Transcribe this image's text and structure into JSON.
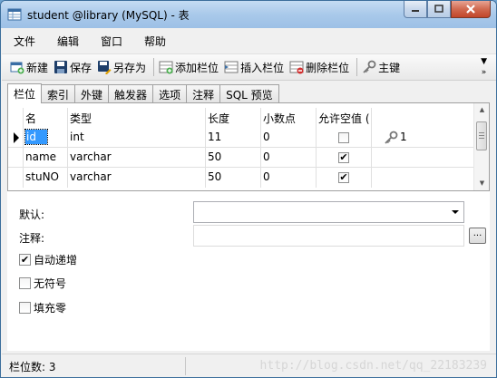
{
  "window": {
    "title": "student @library (MySQL) - 表"
  },
  "menu": [
    "文件",
    "编辑",
    "窗口",
    "帮助"
  ],
  "toolbar": {
    "new_label": "新建",
    "save_label": "保存",
    "save_as_label": "另存为",
    "add_field_label": "添加栏位",
    "insert_field_label": "插入栏位",
    "delete_field_label": "删除栏位",
    "primary_key_label": "主键"
  },
  "tabs": [
    "栏位",
    "索引",
    "外键",
    "触发器",
    "选项",
    "注释",
    "SQL 预览"
  ],
  "grid": {
    "columns": [
      "名",
      "类型",
      "长度",
      "小数点",
      "允许空值 ("
    ],
    "rows": [
      {
        "name": "id",
        "type": "int",
        "length": "11",
        "decimals": "0",
        "nullable": false,
        "key": "1"
      },
      {
        "name": "name",
        "type": "varchar",
        "length": "50",
        "decimals": "0",
        "nullable": true,
        "key": ""
      },
      {
        "name": "stuNO",
        "type": "varchar",
        "length": "50",
        "decimals": "0",
        "nullable": true,
        "key": ""
      }
    ]
  },
  "properties": {
    "default_label": "默认:",
    "default_value": "",
    "comment_label": "注释:",
    "comment_value": "",
    "dots_label": "...",
    "options": [
      {
        "label": "自动递增",
        "checked": true
      },
      {
        "label": "无符号",
        "checked": false
      },
      {
        "label": "填充零",
        "checked": false
      }
    ]
  },
  "status": {
    "field_count": "栏位数: 3",
    "watermark": "http://blog.csdn.net/qq_22183239"
  }
}
